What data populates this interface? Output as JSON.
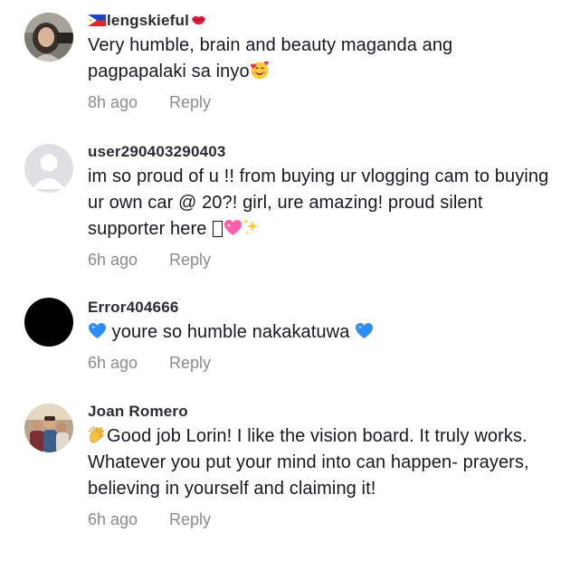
{
  "comments": [
    {
      "username": "lengskieful",
      "username_prefix_icon": "philippines-flag-icon",
      "username_suffix_icon": "lips-icon",
      "text": "Very humble, brain and beauty maganda ang pagpapalaki sa inyo",
      "text_suffix_icon": "smiling-face-with-hearts-icon",
      "time": "8h ago",
      "reply_label": "Reply",
      "avatar": "photo"
    },
    {
      "username": "user290403290403",
      "text": "im so proud of u !! from buying ur vlogging cam to buying ur own car @ 20?! girl, ure amazing! proud silent supporter here ",
      "text_suffix_icons": [
        "unrendered-glyph-box",
        "sparkling-heart-icon",
        "sparkles-icon"
      ],
      "time": "6h ago",
      "reply_label": "Reply",
      "avatar": "default"
    },
    {
      "username": "Error404666",
      "text": " youre so humble nakakatuwa ",
      "text_prefix_icon": "blue-heart-icon",
      "text_suffix_icon": "blue-heart-icon",
      "time": "6h ago",
      "reply_label": "Reply",
      "avatar": "black"
    },
    {
      "username": "Joan Romero",
      "text": "Good job Lorin! I like the vision board. It truly works. Whatever you put your mind into can happen- prayers, believing in yourself and claiming it!",
      "text_prefix_icon": "clapping-hands-icon",
      "time": "6h ago",
      "reply_label": "Reply",
      "avatar": "photo"
    }
  ],
  "colors": {
    "text": "#161823",
    "meta": "#8a8b91",
    "blue_heart": "#2f8cf0",
    "pink_heart": "#ff5fa8"
  }
}
